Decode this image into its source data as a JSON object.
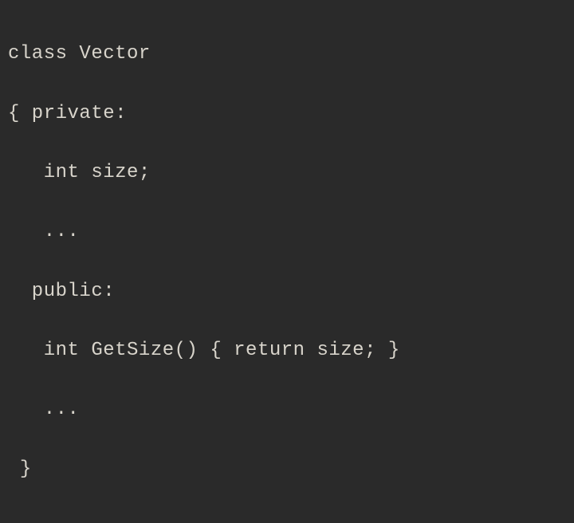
{
  "code": {
    "lines": [
      "class Vector",
      "{ private:",
      "   int size;",
      "   ...",
      "  public:",
      "   int GetSize() { return size; }",
      "   ...",
      " }"
    ]
  }
}
